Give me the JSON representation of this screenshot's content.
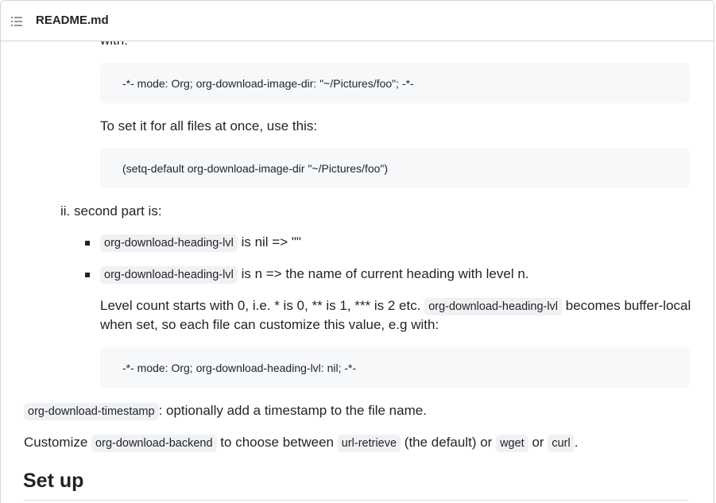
{
  "header": {
    "file_name": "README.md",
    "toc_icon": "list-unordered-icon"
  },
  "content": {
    "partial_top": "with:",
    "code1": "-*- mode: Org; org-download-image-dir: \"~/Pictures/foo\"; -*-",
    "para_all_files": "To set it for all files at once, use this:",
    "code2": "(setq-default org-download-image-dir \"~/Pictures/foo\")",
    "list_ii": "ii. second part is:",
    "bullet1": {
      "code": "org-download-heading-lvl",
      "text": "is nil => \"\""
    },
    "bullet2": {
      "code": "org-download-heading-lvl",
      "text": "is n => the name of current heading with level n."
    },
    "level_para": {
      "before": "Level count starts with 0, i.e. * is 0, ** is 1, *** is 2 etc.",
      "code": "org-download-heading-lvl",
      "after": "becomes buffer-local",
      "line2": "when set, so each file can customize this value, e.g with:"
    },
    "code3": "-*- mode: Org; org-download-heading-lvl: nil; -*-",
    "timestamp_line": {
      "code": "org-download-timestamp",
      "text": ": optionally add a timestamp to the file name."
    },
    "backend_line": {
      "t1": "Customize",
      "c1": "org-download-backend",
      "t2": "to choose between",
      "c2": "url-retrieve",
      "t3": "(the default) or",
      "c3": "wget",
      "t4": "or",
      "c4": "curl",
      "t5": "."
    },
    "setup_heading": "Set up"
  }
}
